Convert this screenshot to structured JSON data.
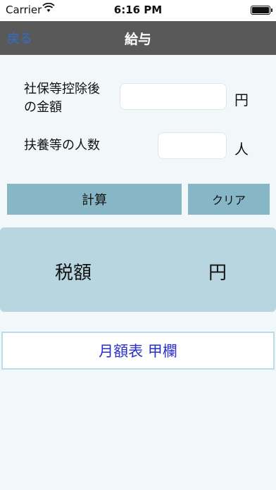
{
  "status_bar": {
    "carrier": "Carrier",
    "time": "6:16 PM",
    "wifi_icon": "wifi-icon",
    "battery_icon": "battery-icon"
  },
  "nav": {
    "back_label": "戻る",
    "title": "給与"
  },
  "form": {
    "net_income": {
      "label_line1": "社保等控除後",
      "label_line2": "の金額",
      "value": "",
      "unit": "円"
    },
    "dependents": {
      "label": "扶養等の人数",
      "value": "",
      "unit": "人"
    }
  },
  "actions": {
    "calculate_label": "計算",
    "clear_label": "クリア"
  },
  "result": {
    "label": "税額",
    "value": "",
    "unit": "円"
  },
  "table_link": {
    "label": "月額表 甲欄"
  },
  "colors": {
    "nav_bg": "#595959",
    "back_link": "#2f6ecf",
    "button_bg": "#87b7c7",
    "result_bg": "#b8d6e0",
    "link_text": "#2a2fc9",
    "page_bg": "#f2f8f9"
  }
}
